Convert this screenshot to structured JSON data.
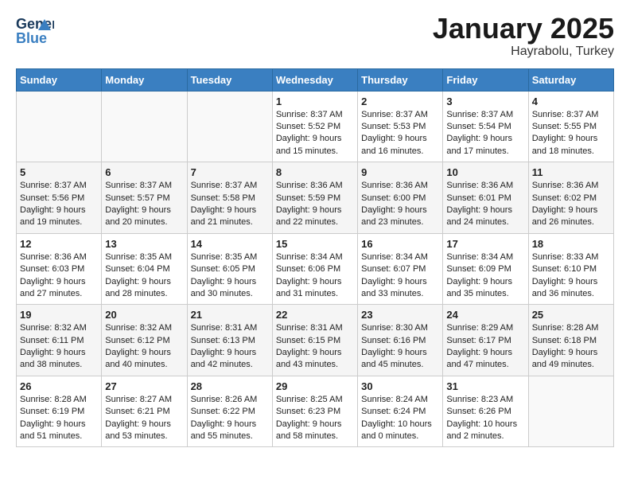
{
  "header": {
    "logo_line1": "General",
    "logo_line2": "Blue",
    "month": "January 2025",
    "location": "Hayrabolu, Turkey"
  },
  "weekdays": [
    "Sunday",
    "Monday",
    "Tuesday",
    "Wednesday",
    "Thursday",
    "Friday",
    "Saturday"
  ],
  "weeks": [
    [
      {
        "day": "",
        "text": ""
      },
      {
        "day": "",
        "text": ""
      },
      {
        "day": "",
        "text": ""
      },
      {
        "day": "1",
        "text": "Sunrise: 8:37 AM\nSunset: 5:52 PM\nDaylight: 9 hours\nand 15 minutes."
      },
      {
        "day": "2",
        "text": "Sunrise: 8:37 AM\nSunset: 5:53 PM\nDaylight: 9 hours\nand 16 minutes."
      },
      {
        "day": "3",
        "text": "Sunrise: 8:37 AM\nSunset: 5:54 PM\nDaylight: 9 hours\nand 17 minutes."
      },
      {
        "day": "4",
        "text": "Sunrise: 8:37 AM\nSunset: 5:55 PM\nDaylight: 9 hours\nand 18 minutes."
      }
    ],
    [
      {
        "day": "5",
        "text": "Sunrise: 8:37 AM\nSunset: 5:56 PM\nDaylight: 9 hours\nand 19 minutes."
      },
      {
        "day": "6",
        "text": "Sunrise: 8:37 AM\nSunset: 5:57 PM\nDaylight: 9 hours\nand 20 minutes."
      },
      {
        "day": "7",
        "text": "Sunrise: 8:37 AM\nSunset: 5:58 PM\nDaylight: 9 hours\nand 21 minutes."
      },
      {
        "day": "8",
        "text": "Sunrise: 8:36 AM\nSunset: 5:59 PM\nDaylight: 9 hours\nand 22 minutes."
      },
      {
        "day": "9",
        "text": "Sunrise: 8:36 AM\nSunset: 6:00 PM\nDaylight: 9 hours\nand 23 minutes."
      },
      {
        "day": "10",
        "text": "Sunrise: 8:36 AM\nSunset: 6:01 PM\nDaylight: 9 hours\nand 24 minutes."
      },
      {
        "day": "11",
        "text": "Sunrise: 8:36 AM\nSunset: 6:02 PM\nDaylight: 9 hours\nand 26 minutes."
      }
    ],
    [
      {
        "day": "12",
        "text": "Sunrise: 8:36 AM\nSunset: 6:03 PM\nDaylight: 9 hours\nand 27 minutes."
      },
      {
        "day": "13",
        "text": "Sunrise: 8:35 AM\nSunset: 6:04 PM\nDaylight: 9 hours\nand 28 minutes."
      },
      {
        "day": "14",
        "text": "Sunrise: 8:35 AM\nSunset: 6:05 PM\nDaylight: 9 hours\nand 30 minutes."
      },
      {
        "day": "15",
        "text": "Sunrise: 8:34 AM\nSunset: 6:06 PM\nDaylight: 9 hours\nand 31 minutes."
      },
      {
        "day": "16",
        "text": "Sunrise: 8:34 AM\nSunset: 6:07 PM\nDaylight: 9 hours\nand 33 minutes."
      },
      {
        "day": "17",
        "text": "Sunrise: 8:34 AM\nSunset: 6:09 PM\nDaylight: 9 hours\nand 35 minutes."
      },
      {
        "day": "18",
        "text": "Sunrise: 8:33 AM\nSunset: 6:10 PM\nDaylight: 9 hours\nand 36 minutes."
      }
    ],
    [
      {
        "day": "19",
        "text": "Sunrise: 8:32 AM\nSunset: 6:11 PM\nDaylight: 9 hours\nand 38 minutes."
      },
      {
        "day": "20",
        "text": "Sunrise: 8:32 AM\nSunset: 6:12 PM\nDaylight: 9 hours\nand 40 minutes."
      },
      {
        "day": "21",
        "text": "Sunrise: 8:31 AM\nSunset: 6:13 PM\nDaylight: 9 hours\nand 42 minutes."
      },
      {
        "day": "22",
        "text": "Sunrise: 8:31 AM\nSunset: 6:15 PM\nDaylight: 9 hours\nand 43 minutes."
      },
      {
        "day": "23",
        "text": "Sunrise: 8:30 AM\nSunset: 6:16 PM\nDaylight: 9 hours\nand 45 minutes."
      },
      {
        "day": "24",
        "text": "Sunrise: 8:29 AM\nSunset: 6:17 PM\nDaylight: 9 hours\nand 47 minutes."
      },
      {
        "day": "25",
        "text": "Sunrise: 8:28 AM\nSunset: 6:18 PM\nDaylight: 9 hours\nand 49 minutes."
      }
    ],
    [
      {
        "day": "26",
        "text": "Sunrise: 8:28 AM\nSunset: 6:19 PM\nDaylight: 9 hours\nand 51 minutes."
      },
      {
        "day": "27",
        "text": "Sunrise: 8:27 AM\nSunset: 6:21 PM\nDaylight: 9 hours\nand 53 minutes."
      },
      {
        "day": "28",
        "text": "Sunrise: 8:26 AM\nSunset: 6:22 PM\nDaylight: 9 hours\nand 55 minutes."
      },
      {
        "day": "29",
        "text": "Sunrise: 8:25 AM\nSunset: 6:23 PM\nDaylight: 9 hours\nand 58 minutes."
      },
      {
        "day": "30",
        "text": "Sunrise: 8:24 AM\nSunset: 6:24 PM\nDaylight: 10 hours\nand 0 minutes."
      },
      {
        "day": "31",
        "text": "Sunrise: 8:23 AM\nSunset: 6:26 PM\nDaylight: 10 hours\nand 2 minutes."
      },
      {
        "day": "",
        "text": ""
      }
    ]
  ]
}
